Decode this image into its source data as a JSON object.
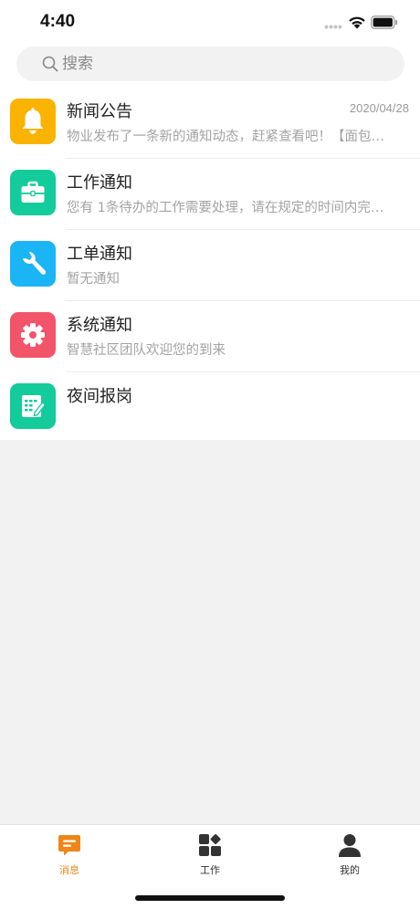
{
  "status_bar": {
    "time": "4:40"
  },
  "search": {
    "placeholder": "搜索",
    "value": ""
  },
  "messages": [
    {
      "title": "新闻公告",
      "date": "2020/04/28",
      "subtitle": "物业发布了一条新的通知动态，赶紧查看吧！【面包…",
      "icon": "bell-icon",
      "color": "#FBB301"
    },
    {
      "title": "工作通知",
      "date": "",
      "subtitle": "您有 1条待办的工作需要处理，请在规定的时间内完…",
      "icon": "briefcase-icon",
      "color": "#13CB9B"
    },
    {
      "title": "工单通知",
      "date": "",
      "subtitle": "暂无通知",
      "icon": "wrench-icon",
      "color": "#1BB5F5"
    },
    {
      "title": "系统通知",
      "date": "",
      "subtitle": "智慧社区团队欢迎您的到来",
      "icon": "gear-icon",
      "color": "#F2556A"
    },
    {
      "title": "夜间报岗",
      "date": "",
      "subtitle": "",
      "icon": "edit-form-icon",
      "color": "#13CB9B"
    }
  ],
  "tabs": [
    {
      "label": "消息",
      "icon": "message-icon",
      "active": true
    },
    {
      "label": "工作",
      "icon": "apps-grid-icon",
      "active": false
    },
    {
      "label": "我的",
      "icon": "user-icon",
      "active": false
    }
  ],
  "colors": {
    "accent": "#F08519",
    "background": "#F2F2F2"
  }
}
